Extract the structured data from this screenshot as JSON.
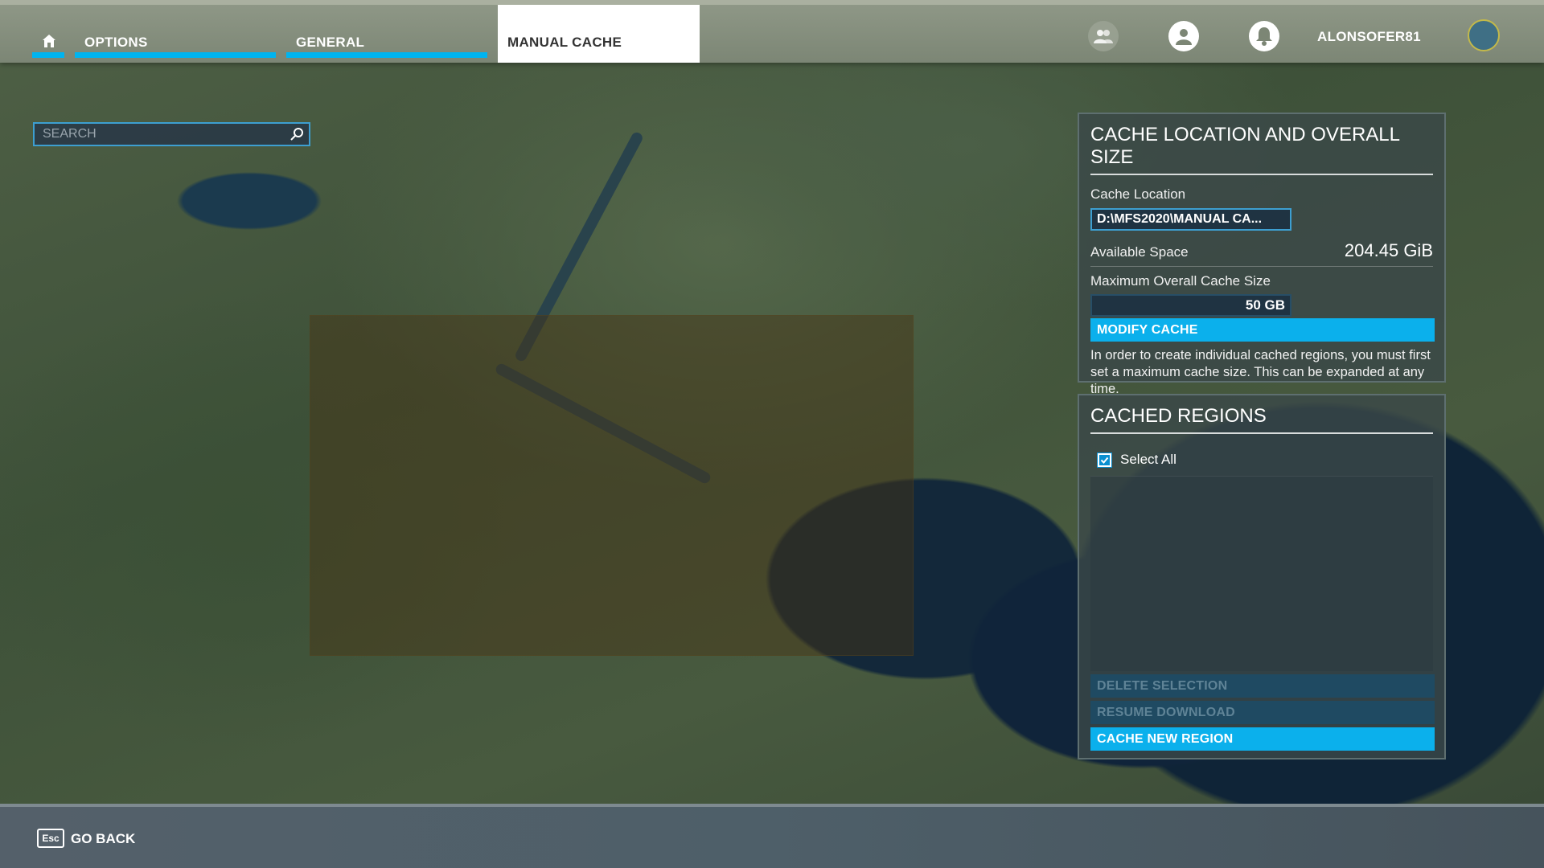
{
  "header": {
    "tabs": [
      {
        "label": "OPTIONS"
      },
      {
        "label": "GENERAL"
      },
      {
        "label": "MANUAL CACHE"
      }
    ],
    "username": "ALONSOFER81",
    "icons": [
      "home-icon",
      "friends-icon",
      "profile-icon",
      "notifications-icon",
      "avatar"
    ]
  },
  "search": {
    "placeholder": "SEARCH"
  },
  "cache_panel": {
    "title": "CACHE LOCATION AND OVERALL SIZE",
    "location_label": "Cache Location",
    "location_value": "D:\\MFS2020\\MANUAL CA...",
    "available_label": "Available Space",
    "available_value": "204.45 GiB",
    "max_size_label": "Maximum Overall Cache Size",
    "max_size_value": "50 GB",
    "modify_button": "MODIFY CACHE",
    "info_text": "In order to create individual cached regions, you must first set a maximum cache size. This can be expanded at any time."
  },
  "regions_panel": {
    "title": "CACHED REGIONS",
    "select_all_label": "Select All",
    "select_all_checked": true,
    "delete_button": "DELETE SELECTION",
    "resume_button": "RESUME DOWNLOAD",
    "cache_new_button": "CACHE NEW REGION"
  },
  "footer": {
    "esc_key": "Esc",
    "go_back": "GO BACK"
  },
  "colors": {
    "accent": "#0bb0ec",
    "disabled_button": "#1f4a62",
    "panel_bg": "#3a4848"
  }
}
